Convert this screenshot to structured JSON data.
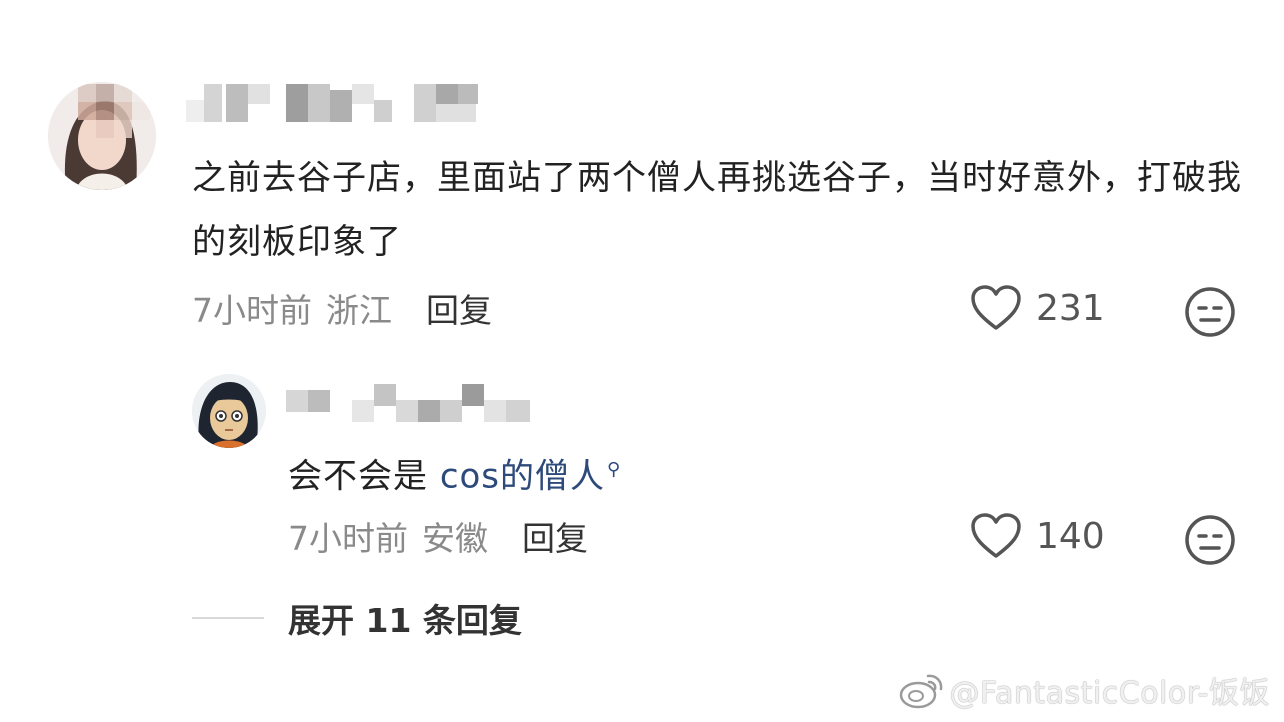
{
  "comment": {
    "text": "之前去谷子店，里面站了两个僧人再挑选谷子，当时好意外，打破我的刻板印象了",
    "time": "7小时前",
    "location": "浙江",
    "reply_label": "回复",
    "likes": "231",
    "heart_icon": "heart-outline-icon",
    "reaction_icon": "neutral-face-icon"
  },
  "reply": {
    "text_prefix": "会不会是 ",
    "link_text": "cos的僧人",
    "search_icon": "search-icon",
    "time": "7小时前",
    "location": "安徽",
    "reply_label": "回复",
    "likes": "140"
  },
  "expand": {
    "label": "展开 11 条回复"
  },
  "watermark": {
    "text": "@FantasticColor-饭饭",
    "icon": "weibo-logo-icon"
  },
  "colors": {
    "text_primary": "#222222",
    "text_meta": "#8a8a8a",
    "link": "#2d4a7a",
    "background": "#ffffff"
  }
}
